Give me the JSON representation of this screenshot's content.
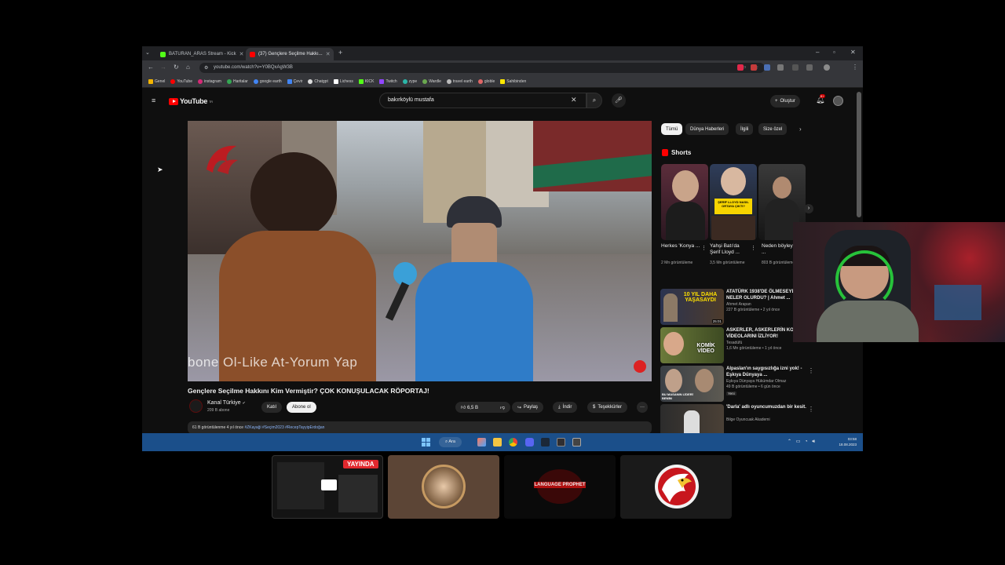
{
  "browser": {
    "tabs": [
      {
        "label": "BATURAN_ARAS Stream - Kick",
        "active": false
      },
      {
        "label": "(37) Gençlere Seçilme Hakkı...",
        "active": true
      }
    ],
    "new_tab": "+",
    "url": "youtube.com/watch?v=Y0BQxAgW3B",
    "bookmarks": [
      "Genel",
      "YouTube",
      "instagram",
      "Haritalar",
      "google earth",
      "Çevir",
      "Chatgpt",
      "Lichess",
      "KICK",
      "Twitch",
      "zype",
      "Wardle",
      "travel earth",
      "globle",
      "Sahibinden"
    ]
  },
  "youtube": {
    "logo": "YouTube",
    "logo_region": "TR",
    "search_query": "bakırköylü mustafa",
    "create_label": "Oluştur",
    "notification_count": "9+"
  },
  "video": {
    "overlay_text": "bone Ol-Like At-Yorum Yap",
    "title": "Gençlere Seçilme Hakkını Kim Vermiştir? ÇOK KONUŞULACAK RÖPORTAJ!",
    "channel": "Kanal Türkiye",
    "subscribers": "209 B abone",
    "join_label": "Katıl",
    "subscribe_label": "Abone ol",
    "likes": "6,5 B",
    "share_label": "Paylaş",
    "download_label": "İndir",
    "thanks_label": "Teşekkürler",
    "more_label": "···",
    "description_meta": "61 B görüntülenme  4 yıl önce",
    "description_tags": "#ZKayaği #Seçim2023 #RecepTayyipErdoğan"
  },
  "sidebar": {
    "chips": [
      "Tümü",
      "Dünya Haberleri",
      "İlgili",
      "Size özel"
    ],
    "shorts_heading": "Shorts",
    "shorts": [
      {
        "title": "Herkes 'Konya ...",
        "views": "2 Mn görüntüleme"
      },
      {
        "title": "Yahşi Batı'da Şerif Lloyd ...",
        "views": "3,5 Mn görüntüleme"
      },
      {
        "title": "Neden böyleyiz? | ...",
        "views": "803 B görüntüleme"
      }
    ],
    "short_thumb_text": [
      "",
      "ŞERİF LLOYD NASIL ORTAYA ÇIKTI?",
      ""
    ],
    "recommendations": [
      {
        "title": "ATATÜRK 1938'DE ÖLMESEYDİ NELER OLURDU? | Ahmet ...",
        "channel": "Ahmet Arapan",
        "meta": "227 B görüntüleme • 2 yıl önce",
        "thumb_text": "10 YIL DAHA YAŞASAYDI",
        "duration": "25:01"
      },
      {
        "title": "ASKERLER, ASKERLERİN KOMİK VİDEOLARINI İZLİYOR!",
        "channel": "Tesadüfü",
        "meta": "1,6 Mn görüntüleme • 1 yıl önce",
        "thumb_text": "KOMİK VİDEO",
        "duration": ""
      },
      {
        "title": "Alpaslan'ın saygısızlığa izni yok! - Eşkıya Dünyaya ...",
        "channel": "Eşkıya Dünyaya Hükümdar Olmaz",
        "meta": "49 B görüntüleme • 6 gün önce",
        "badge": "Yeni",
        "thumb_text": "BU MASANIN LİDERİ BENİM",
        "duration": ""
      },
      {
        "title": "'Darla' adlı oyuncumuzdan bir kesit.",
        "channel": "Bilge Oyuncuak Akademi",
        "meta": "",
        "thumb_text": "",
        "duration": ""
      }
    ]
  },
  "taskbar": {
    "search_label": "Ara",
    "time": "03:58",
    "date": "18.08.2023"
  },
  "stream": {
    "live_label": "YAYINDA",
    "card3_text": "LANGUAGE PROPHET"
  },
  "colors": {
    "yt_red": "#ff0000",
    "background": "#0f0f0f",
    "taskbar": "#1b4f8a",
    "live_red": "#e0282e"
  }
}
